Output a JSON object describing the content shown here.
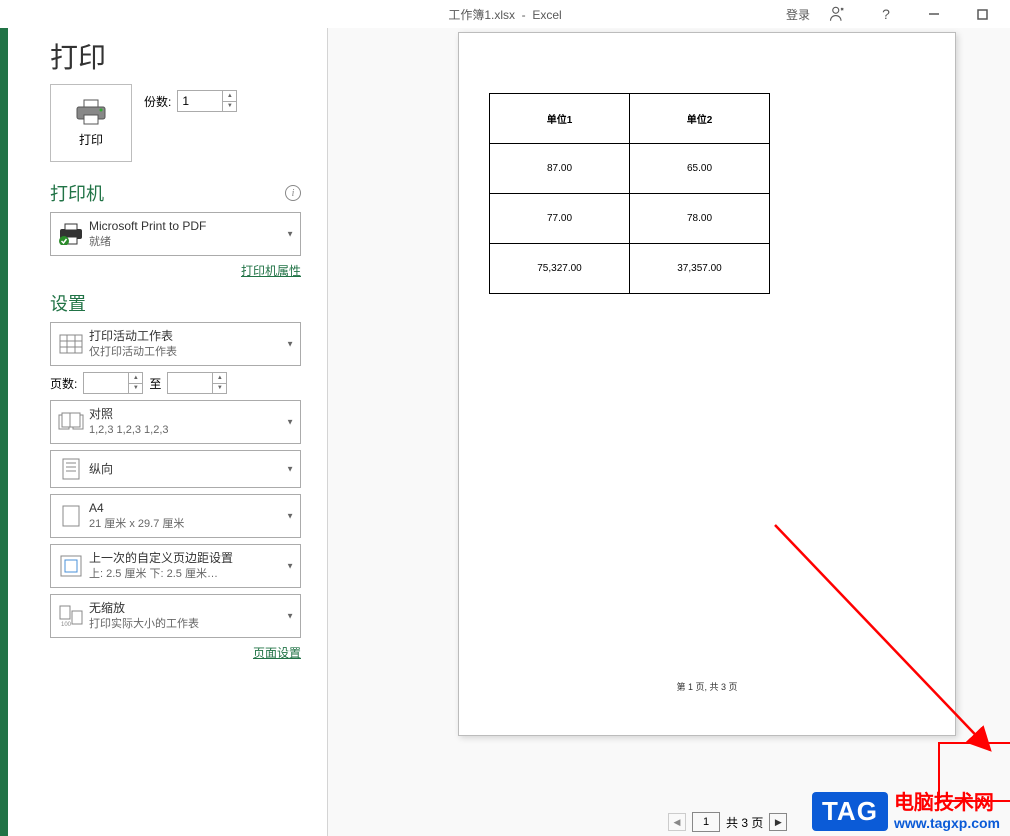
{
  "titlebar": {
    "filename": "工作簿1.xlsx",
    "app": "Excel",
    "login": "登录"
  },
  "print": {
    "heading": "打印",
    "button_label": "打印",
    "copies_label": "份数:",
    "copies_value": "1"
  },
  "printer": {
    "section": "打印机",
    "name": "Microsoft Print to PDF",
    "status": "就绪",
    "properties_link": "打印机属性"
  },
  "settings": {
    "section": "设置",
    "print_what": {
      "l1": "打印活动工作表",
      "l2": "仅打印活动工作表"
    },
    "pages_label": "页数:",
    "pages_to": "至",
    "collate": {
      "l1": "对照",
      "l2": "1,2,3    1,2,3    1,2,3"
    },
    "orientation": {
      "l1": "纵向"
    },
    "paper": {
      "l1": "A4",
      "l2": "21 厘米 x 29.7 厘米"
    },
    "margins": {
      "l1": "上一次的自定义页边距设置",
      "l2": "上: 2.5 厘米 下: 2.5 厘米…"
    },
    "scaling": {
      "l1": "无缩放",
      "l2": "打印实际大小的工作表"
    },
    "page_setup_link": "页面设置"
  },
  "preview_table": {
    "headers": [
      "单位1",
      "单位2"
    ],
    "rows": [
      [
        "87.00",
        "65.00"
      ],
      [
        "77.00",
        "78.00"
      ],
      [
        "75,327.00",
        "37,357.00"
      ]
    ],
    "footer": "第 1 页, 共 3 页"
  },
  "pager": {
    "current": "1",
    "total_label": "共 3 页"
  },
  "watermark": {
    "tag": "TAG",
    "l1": "电脑技术网",
    "l2": "www.tagxp.com"
  }
}
